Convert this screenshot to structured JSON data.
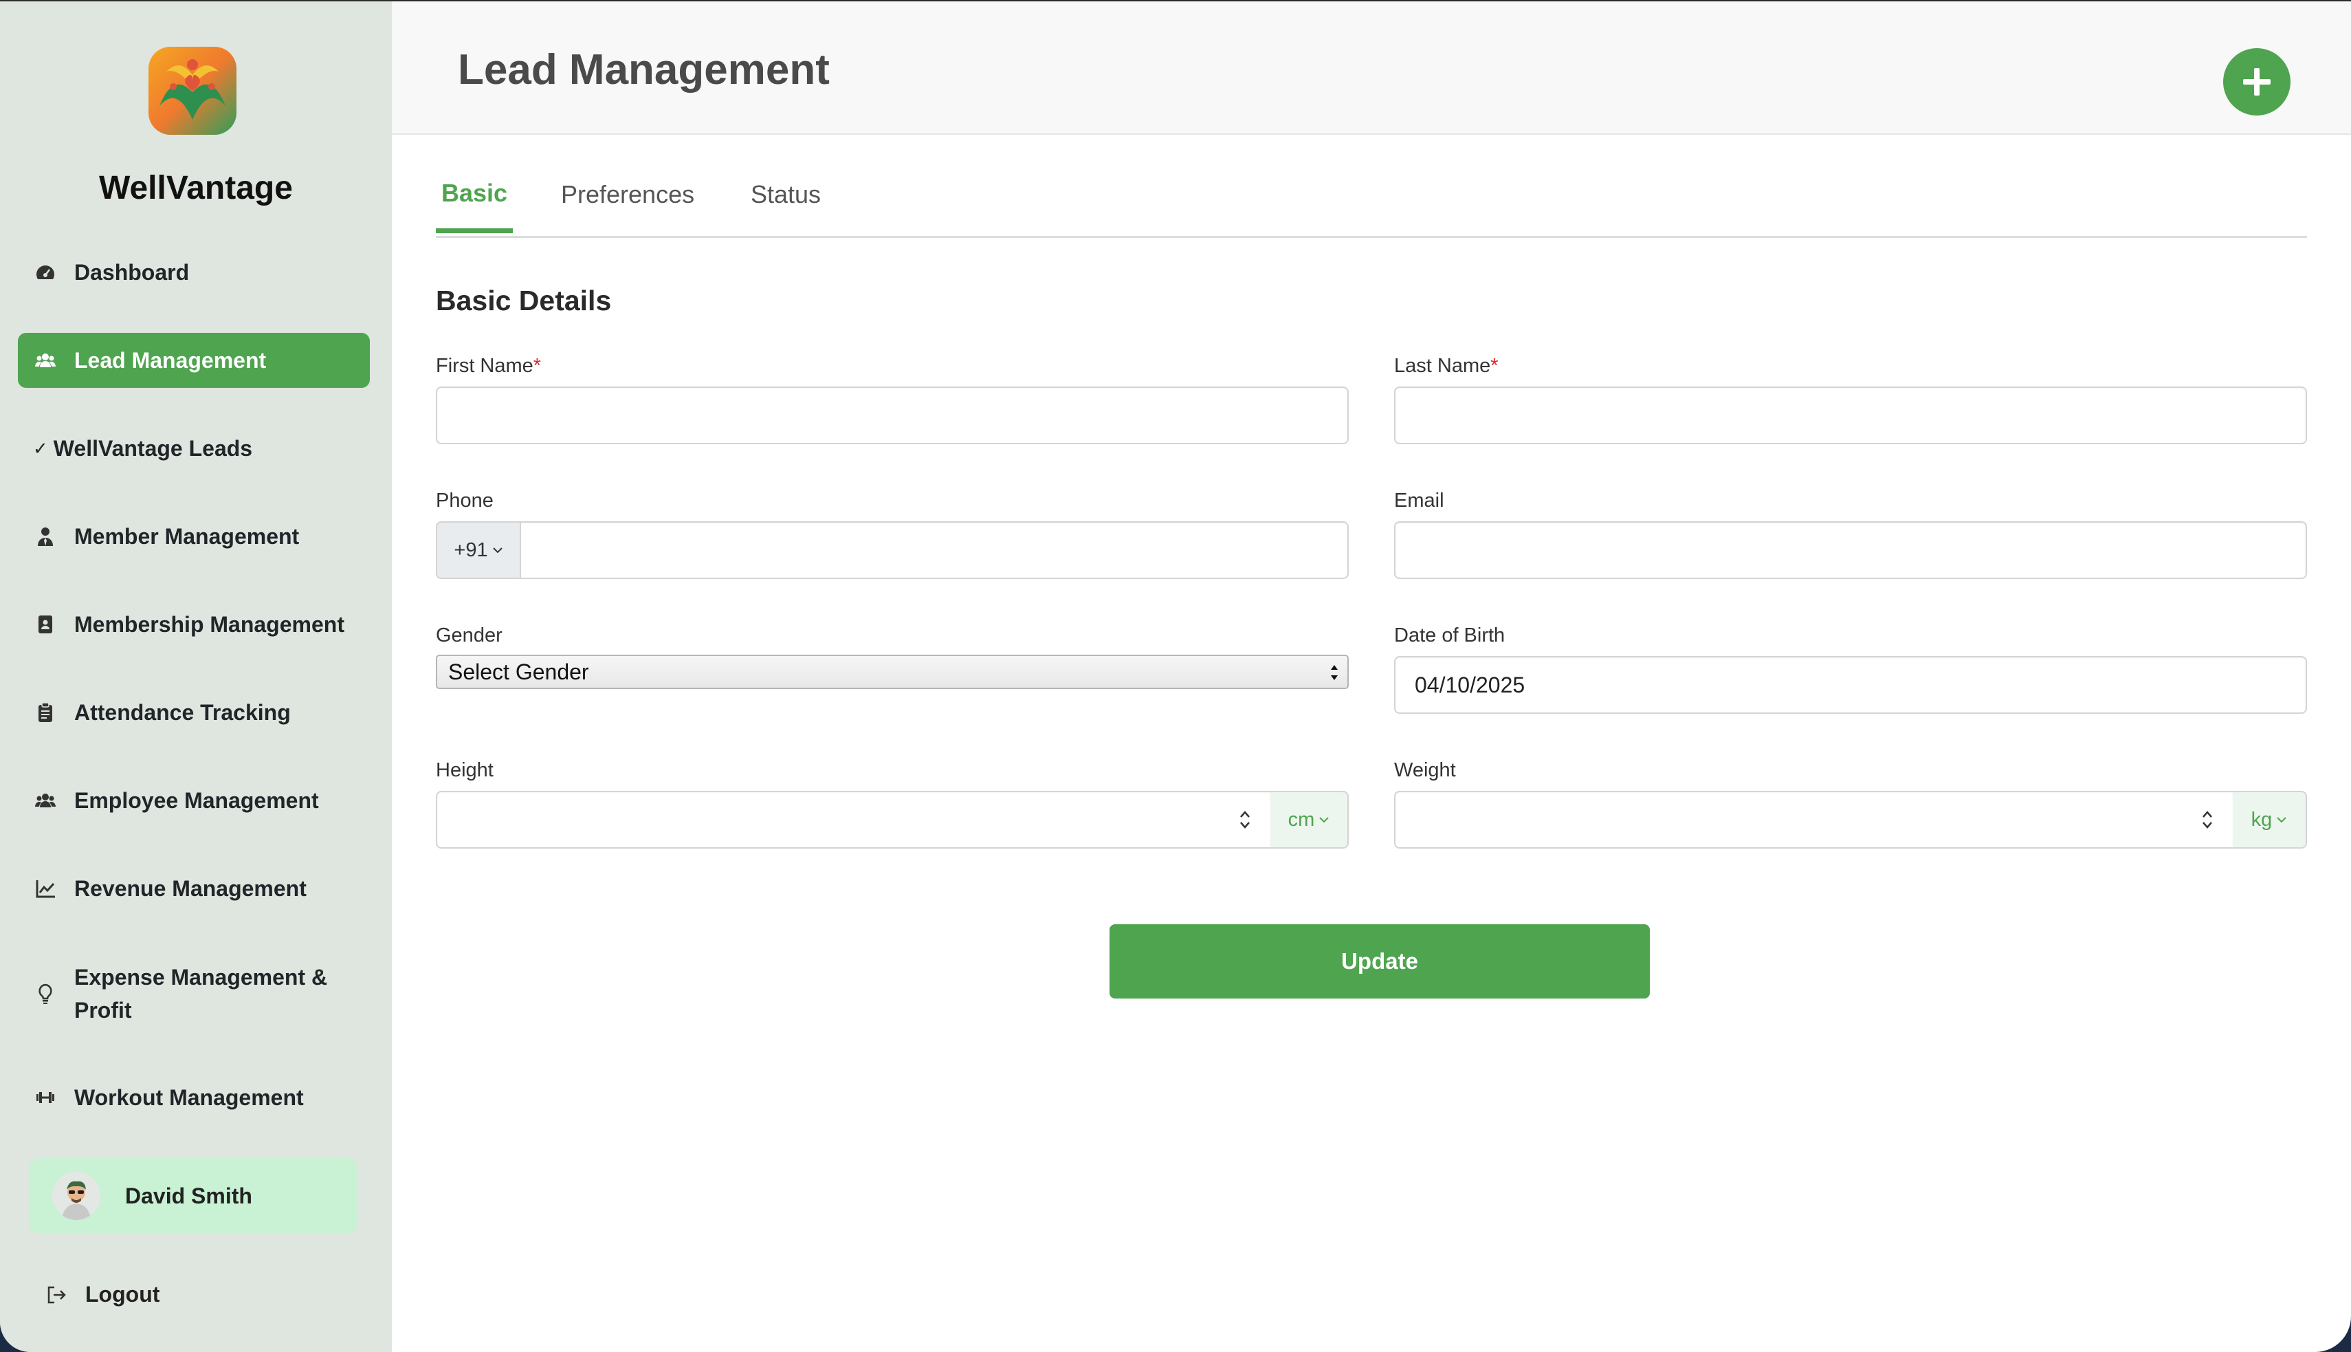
{
  "app": {
    "brand": "WellVantage"
  },
  "sidebar": {
    "items": [
      {
        "label": "Dashboard",
        "icon": "speedometer-icon"
      },
      {
        "label": "Lead Management",
        "icon": "users-icon",
        "active": true
      },
      {
        "label": "WellVantage Leads",
        "prefix": "✓"
      },
      {
        "label": "Member Management",
        "icon": "user-tie-icon"
      },
      {
        "label": "Membership Management",
        "icon": "id-card-icon"
      },
      {
        "label": "Attendance Tracking",
        "icon": "clipboard-icon"
      },
      {
        "label": "Employee Management",
        "icon": "users-icon"
      },
      {
        "label": "Revenue Management",
        "icon": "chart-line-icon"
      },
      {
        "label": "Expense Management & Profit",
        "icon": "lightbulb-icon"
      },
      {
        "label": "Workout Management",
        "icon": "dumbbell-icon"
      }
    ],
    "user": {
      "name": "David Smith"
    },
    "logout_label": "Logout"
  },
  "header": {
    "title": "Lead Management",
    "add_icon": "plus-circle-icon"
  },
  "tabs": [
    {
      "label": "Basic",
      "active": true
    },
    {
      "label": "Preferences"
    },
    {
      "label": "Status"
    }
  ],
  "form": {
    "section_title": "Basic Details",
    "first_name": {
      "label": "First Name",
      "required_mark": "*",
      "value": ""
    },
    "last_name": {
      "label": "Last Name",
      "required_mark": "*",
      "value": ""
    },
    "phone": {
      "label": "Phone",
      "country_code": "+91",
      "value": ""
    },
    "email": {
      "label": "Email",
      "value": ""
    },
    "gender": {
      "label": "Gender",
      "selected": "Select Gender"
    },
    "dob": {
      "label": "Date of Birth",
      "value": "04/10/2025"
    },
    "height": {
      "label": "Height",
      "unit": "cm",
      "value": ""
    },
    "weight": {
      "label": "Weight",
      "unit": "kg",
      "value": ""
    },
    "submit_label": "Update"
  },
  "colors": {
    "accent": "#4fa44f",
    "sidebar_bg": "#dfe5df",
    "user_card_bg": "#c9f1d3",
    "required": "#d62f2f"
  }
}
